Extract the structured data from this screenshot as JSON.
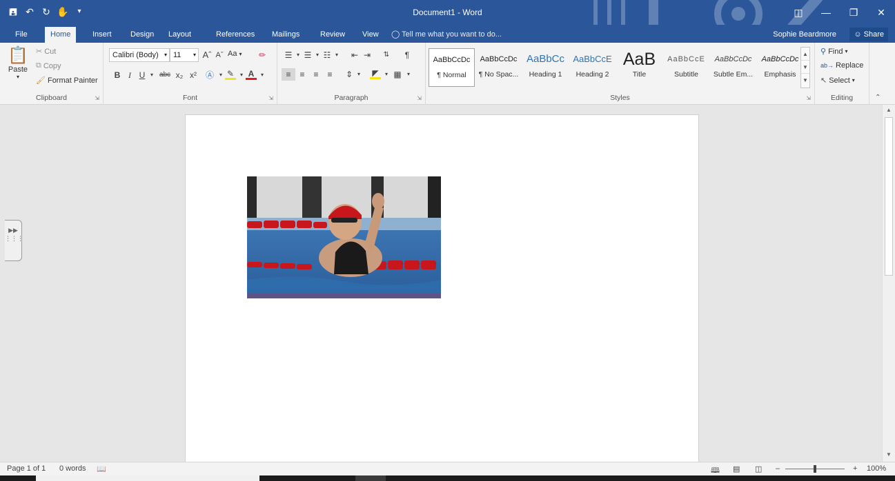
{
  "window": {
    "title": "Document1 - Word"
  },
  "qat": {
    "save": "save-icon",
    "undo": "undo-icon",
    "redo": "redo-icon",
    "touch": "touch-mode-icon"
  },
  "tabs": [
    "File",
    "Home",
    "Insert",
    "Design",
    "Layout",
    "References",
    "Mailings",
    "Review",
    "View"
  ],
  "active_tab": "Home",
  "tell_me": "Tell me what you want to do...",
  "user": {
    "name": "Sophie Beardmore",
    "share_label": "Share"
  },
  "clipboard": {
    "paste": "Paste",
    "cut": "Cut",
    "copy": "Copy",
    "format_painter": "Format Painter",
    "label": "Clipboard"
  },
  "font": {
    "name": "Calibri (Body)",
    "size": "11",
    "change_case": "Aa",
    "label": "Font"
  },
  "paragraph": {
    "label": "Paragraph"
  },
  "styles": {
    "label": "Styles",
    "items": [
      {
        "preview": "AaBbCcDc",
        "name": "¶ Normal"
      },
      {
        "preview": "AaBbCcDc",
        "name": "¶ No Spac..."
      },
      {
        "preview": "AaBbCc",
        "name": "Heading 1"
      },
      {
        "preview": "AaBbCcE",
        "name": "Heading 2"
      },
      {
        "preview": "AaB",
        "name": "Title"
      },
      {
        "preview": "AaBbCcE",
        "name": "Subtitle"
      },
      {
        "preview": "AaBbCcDc",
        "name": "Subtle Em..."
      },
      {
        "preview": "AaBbCcDc",
        "name": "Emphasis"
      }
    ]
  },
  "editing": {
    "find": "Find",
    "replace": "Replace",
    "select": "Select",
    "label": "Editing"
  },
  "status": {
    "page": "Page 1 of 1",
    "words": "0 words",
    "zoom": "100%"
  },
  "colors": {
    "brand": "#2b579a",
    "ribbon": "#f3f3f3",
    "canvas": "#e6e6e6"
  }
}
